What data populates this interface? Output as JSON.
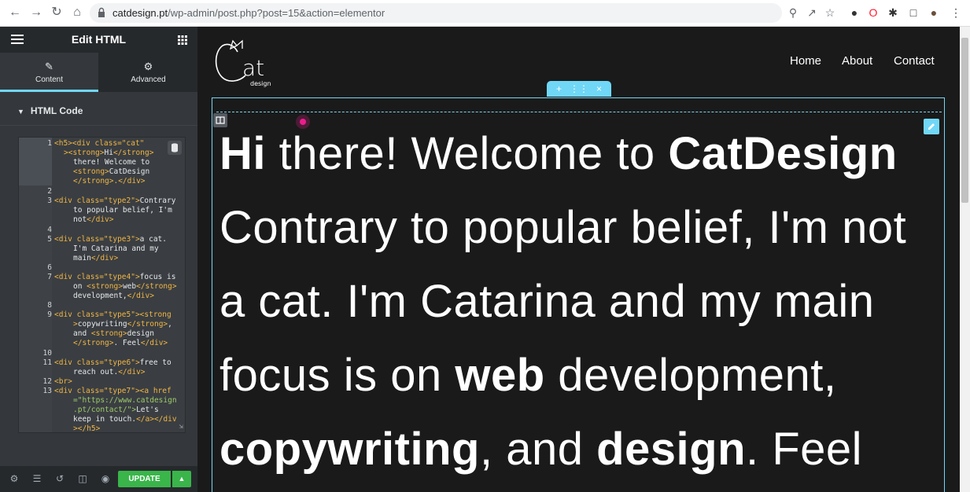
{
  "browser": {
    "url_host": "catdesign.pt",
    "url_path": "/wp-admin/post.php?post=15&action=elementor"
  },
  "panel": {
    "title": "Edit HTML",
    "tabs": [
      {
        "label": "Content",
        "icon": "pencil-icon"
      },
      {
        "label": "Advanced",
        "icon": "gear-icon"
      }
    ],
    "section": "HTML Code",
    "code": {
      "line_numbers": [
        "1",
        "2",
        "3",
        "4",
        "5",
        "6",
        "7",
        "8",
        "9",
        "10",
        "11",
        "12",
        "13"
      ],
      "l1a": "<h5><div class=\"cat\"",
      "l1b": ">",
      "l1c": "<strong>",
      "l1d": "Hi",
      "l1e": "</strong>",
      "l1f": "there! Welcome to",
      "l1g": "<strong>",
      "l1h": "CatDesign",
      "l1i": "</strong>.</div>",
      "l3a": "<div class=\"type2\">",
      "l3b": "Contrary",
      "l3c": "to popular belief, I'm",
      "l3d": "not",
      "l3e": "</div>",
      "l5a": "<div class=\"type3\">",
      "l5b": "a cat.",
      "l5c": "I'm Catarina and my",
      "l5d": "main",
      "l5e": "</div>",
      "l7a": "<div class=\"type4\">",
      "l7b": "focus is",
      "l7c": "on ",
      "l7d": "<strong>",
      "l7e": "web",
      "l7f": "</strong>",
      "l7g": "development,",
      "l7h": "</div>",
      "l9a": "<div class=\"type5\">",
      "l9b": "<strong",
      "l9c": ">",
      "l9d": "copywriting",
      "l9e": "</strong>",
      "l9f": ",",
      "l9g": "and ",
      "l9h": "<strong>",
      "l9i": "design",
      "l9j": "</strong>",
      "l9k": ". Feel",
      "l9l": "</div>",
      "l11a": "<div class=\"type6\">",
      "l11b": "free to",
      "l11c": "reach out.",
      "l11d": "</div>",
      "l12": "<br>",
      "l13a": "<div class=\"type7\"><a href",
      "l13b": "=\"https://www.catdesign",
      "l13c": ".pt/contact/\">",
      "l13d": "Let's",
      "l13e": "keep in touch.",
      "l13f": "</a></div",
      "l13g": "></h5>"
    },
    "update_label": "UPDATE"
  },
  "site": {
    "logo_text": "at",
    "logo_sub": "design",
    "nav": [
      "Home",
      "About",
      "Contact"
    ],
    "hero": {
      "l1_bold": "Hi",
      "l1_mid": " there! Welcome to ",
      "l1_bold2": "CatDesign",
      "l2": "Contrary to popular belief, I'm not",
      "l3": "a cat. I'm Catarina and my main",
      "l4_a": "focus is on ",
      "l4_bold": "web",
      "l4_b": " development,",
      "l5_bold": "copywriting",
      "l5_a": ", and ",
      "l5_bold2": "design",
      "l5_b": ". Feel"
    }
  },
  "colors": {
    "accent": "#71d7f7",
    "update_green": "#39b54a",
    "code_tag": "#f1b544",
    "code_string": "#9ec96a",
    "cursor_pink": "#e91e8c"
  }
}
